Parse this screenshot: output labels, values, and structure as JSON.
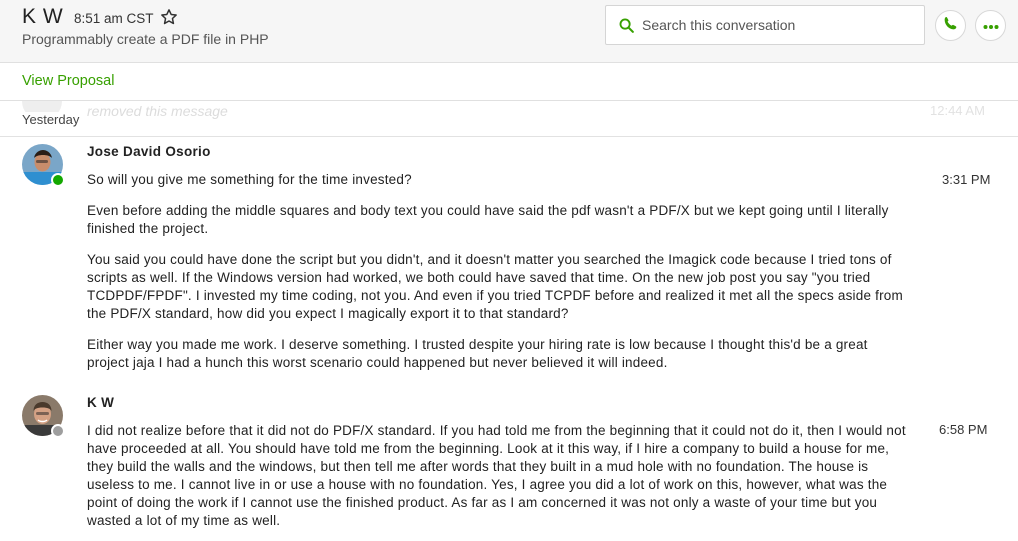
{
  "header": {
    "name": "K W",
    "time": "8:51 am CST",
    "subtitle": "Programmably create a PDF file in PHP",
    "search_placeholder": "Search this conversation"
  },
  "proposal": {
    "link_label": "View Proposal"
  },
  "ghost_row": {
    "text": "removed this message",
    "time": "12:44 AM"
  },
  "day_separator": "Yesterday",
  "colors": {
    "accent": "#37a000",
    "online": "#14a800",
    "offline": "#9e9e9e"
  },
  "messages": [
    {
      "sender": "Jose David Osorio",
      "status": "online",
      "time": "3:31 PM",
      "paragraphs": [
        "So will you give me something for the time invested?",
        "Even before adding the middle squares and body text you could have said the pdf wasn't a PDF/X but we kept going until I literally finished the project.",
        "You said you could have done the script but you didn't, and it doesn't matter you searched the Imagick code because I tried tons of scripts as well. If the Windows version had worked, we both could have saved that time. On the new job post you say \"you tried TCDPDF/FPDF\". I invested my time coding, not you. And even if you tried TCPDF before and realized it met all the specs aside from the PDF/X standard, how did you expect I magically export it to that standard?",
        "Either way you made me work. I deserve something. I trusted despite your hiring rate is low because I thought this'd be a great project jaja I had a hunch this worst scenario could happened but never believed it will indeed."
      ]
    },
    {
      "sender": "K W",
      "status": "offline",
      "time": "6:58 PM",
      "paragraphs": [
        "I did not realize before that it did not do PDF/X standard. If you had told me from the beginning that it could not do it, then I would not have proceeded at all. You should have told me from the beginning. Look at it this way, if I hire a company to build a house for me, they build the walls and the windows, but then tell me after words that they built in a mud hole with no foundation. The house is useless to me. I cannot live in or use a house with no foundation. Yes, I agree you did a lot of work on this, however, what was the point of doing the work if I cannot use the finished product. As far as I am concerned it was not only a waste of your time but you wasted a lot of my time as well."
      ]
    }
  ]
}
